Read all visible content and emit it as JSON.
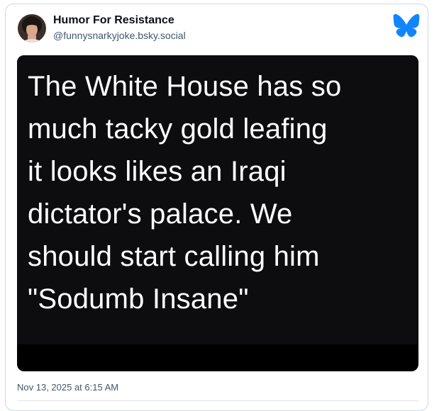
{
  "post": {
    "author_name": "Humor For Resistance",
    "author_handle": "@funnysnarkyjoke.bsky.social",
    "avatar_icon": "user-avatar",
    "platform_icon": "bluesky-butterfly-icon",
    "brand_color": "#1185fe",
    "image_text_lines": [
      "The White House has so",
      "much tacky gold leafing",
      "it looks likes an Iraqi",
      "dictator's palace. We",
      "should start calling him",
      "\"Sodumb Insane\""
    ],
    "timestamp": "Nov 13, 2025 at 6:15 AM"
  }
}
